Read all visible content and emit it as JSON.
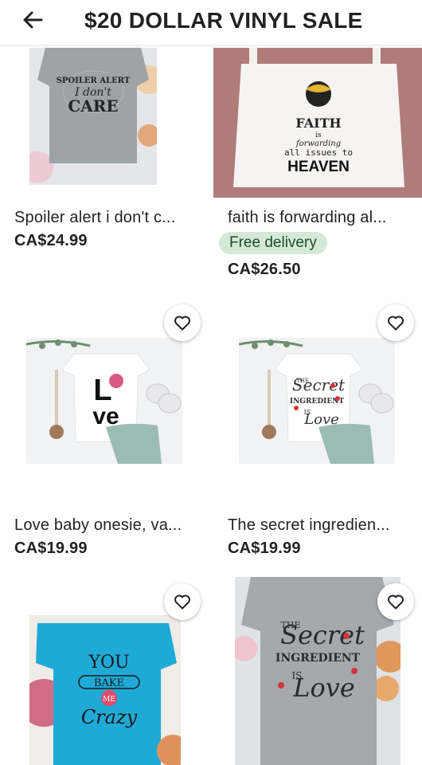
{
  "header": {
    "title": "$20 DOLLAR VINYL SALE"
  },
  "products": [
    {
      "title": "Spoiler alert i don't c...",
      "price": "CA$24.99",
      "art": [
        "SPOILER ALERT",
        "I don't",
        "CARE"
      ]
    },
    {
      "title": "faith is forwarding al...",
      "badge": "Free delivery",
      "price": "CA$26.50",
      "art": [
        "FAITH",
        "is",
        "forwarding",
        "all issues to",
        "HEAVEN"
      ]
    },
    {
      "title": "Love baby onesie, va...",
      "price": "CA$19.99",
      "art": [
        "L",
        "ve"
      ]
    },
    {
      "title": "The secret ingredien...",
      "price": "CA$19.99",
      "art": [
        "THE",
        "Secret",
        "INGREDIENT",
        "IS",
        "Love"
      ]
    },
    {
      "art": [
        "YOU",
        "BAKE",
        "ME",
        "Crazy"
      ]
    },
    {
      "art": [
        "THE",
        "Secret",
        "INGREDIENT",
        "IS",
        "Love"
      ]
    }
  ],
  "colors": {
    "badge_bg": "#d4e9d7",
    "badge_text": "#1f4d2a",
    "tote_bg": "#b07c7b",
    "blue_shirt": "#1fa9d6"
  }
}
